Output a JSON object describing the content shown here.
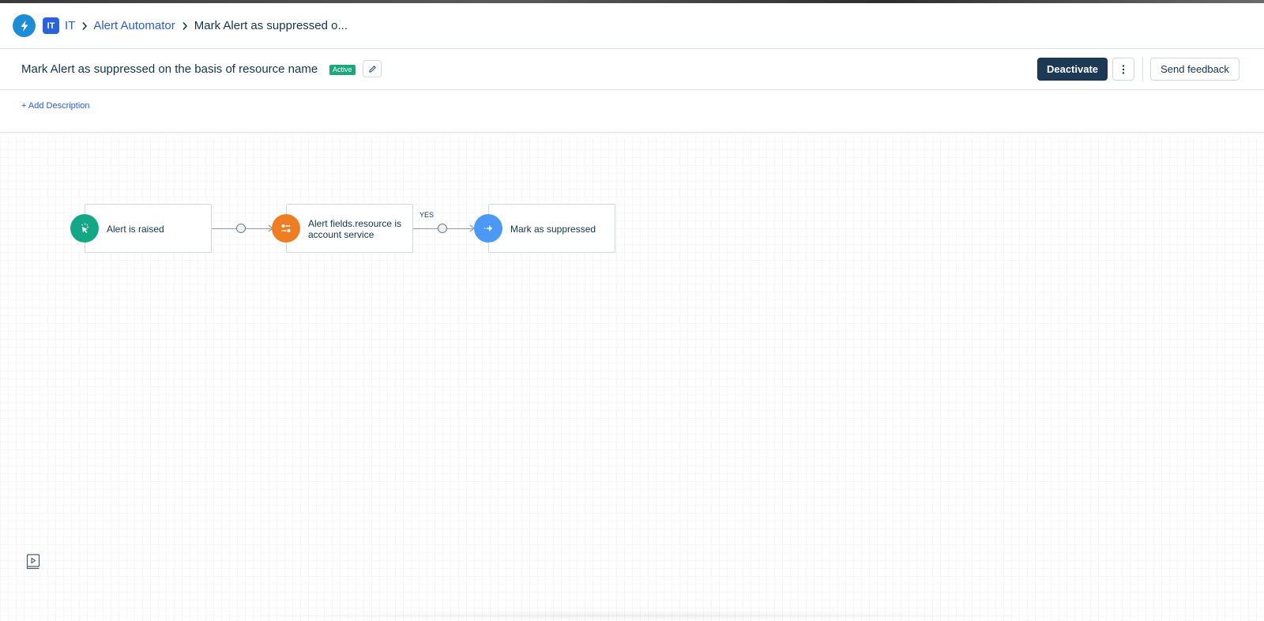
{
  "header": {
    "workspace_badge": "IT",
    "breadcrumb": {
      "workspace": "IT",
      "app": "Alert Automator",
      "current": "Mark Alert as suppressed o..."
    }
  },
  "titlebar": {
    "title": "Mark Alert as suppressed on the basis of resource name",
    "status": "Active",
    "deactivate_label": "Deactivate",
    "feedback_label": "Send feedback"
  },
  "description": {
    "add_label": "+ Add Description"
  },
  "flow": {
    "nodes": [
      {
        "label_line1": "Alert is raised",
        "label_line2": "",
        "icon": "cursor-click-icon",
        "color": "#14a785"
      },
      {
        "label_line1": "Alert fields.resource is",
        "label_line2": "account service",
        "icon": "condition-toggle-icon",
        "color": "#ef7d22"
      },
      {
        "label_line1": "Mark as suppressed",
        "label_line2": "",
        "icon": "action-arrow-icon",
        "color": "#4b98f5"
      }
    ],
    "edge_yes_label": "YES"
  },
  "colors": {
    "primary_dark": "#1c3a55",
    "link": "#2c5cc5",
    "status_active": "#18a87c",
    "app_logo": "#1e8dd6"
  }
}
